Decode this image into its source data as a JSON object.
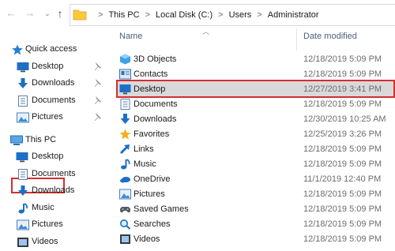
{
  "address": {
    "crumbs": [
      "This PC",
      "Local Disk (C:)",
      "Users",
      "Administrator"
    ],
    "separator": ">"
  },
  "nav": {
    "back_icon": "←",
    "forward_icon": "→",
    "dropdown_icon": "⌄",
    "up_icon": "↑"
  },
  "sidebar": {
    "quick_access": "Quick access",
    "quick_items": [
      {
        "label": "Desktop",
        "icon": "desktop-icon"
      },
      {
        "label": "Downloads",
        "icon": "downloads-icon"
      },
      {
        "label": "Documents",
        "icon": "documents-icon"
      },
      {
        "label": "Pictures",
        "icon": "pictures-icon"
      }
    ],
    "this_pc": "This PC",
    "pc_items": [
      {
        "label": "Desktop",
        "icon": "desktop-icon"
      },
      {
        "label": "Documents",
        "icon": "documents-icon"
      },
      {
        "label": "Downloads",
        "icon": "downloads-icon"
      },
      {
        "label": "Music",
        "icon": "music-icon"
      },
      {
        "label": "Pictures",
        "icon": "pictures-icon"
      },
      {
        "label": "Videos",
        "icon": "videos-icon"
      }
    ]
  },
  "columns": {
    "name": "Name",
    "date": "Date modified"
  },
  "files": [
    {
      "name": "3D Objects",
      "date": "12/18/2019 5:09 PM",
      "icon": "3d-objects-icon"
    },
    {
      "name": "Contacts",
      "date": "12/18/2019 5:09 PM",
      "icon": "contacts-icon"
    },
    {
      "name": "Desktop",
      "date": "12/27/2019 3:41 PM",
      "icon": "desktop-icon"
    },
    {
      "name": "Documents",
      "date": "12/18/2019 5:09 PM",
      "icon": "documents-icon"
    },
    {
      "name": "Downloads",
      "date": "12/30/2019 10:25 AM",
      "icon": "downloads-icon"
    },
    {
      "name": "Favorites",
      "date": "12/25/2019 3:26 PM",
      "icon": "favorites-icon"
    },
    {
      "name": "Links",
      "date": "12/18/2019 5:09 PM",
      "icon": "links-icon"
    },
    {
      "name": "Music",
      "date": "12/18/2019 5:09 PM",
      "icon": "music-icon"
    },
    {
      "name": "OneDrive",
      "date": "11/1/2019 12:40 PM",
      "icon": "onedrive-icon"
    },
    {
      "name": "Pictures",
      "date": "12/18/2019 5:09 PM",
      "icon": "pictures-icon"
    },
    {
      "name": "Saved Games",
      "date": "12/18/2019 5:09 PM",
      "icon": "saved-games-icon"
    },
    {
      "name": "Searches",
      "date": "12/18/2019 5:09 PM",
      "icon": "searches-icon"
    },
    {
      "name": "Videos",
      "date": "12/18/2019 5:09 PM",
      "icon": "videos-icon"
    }
  ],
  "colors": {
    "highlight": "#d32f2f",
    "folder": "#ffc83d",
    "accent": "#1c6fc7"
  }
}
